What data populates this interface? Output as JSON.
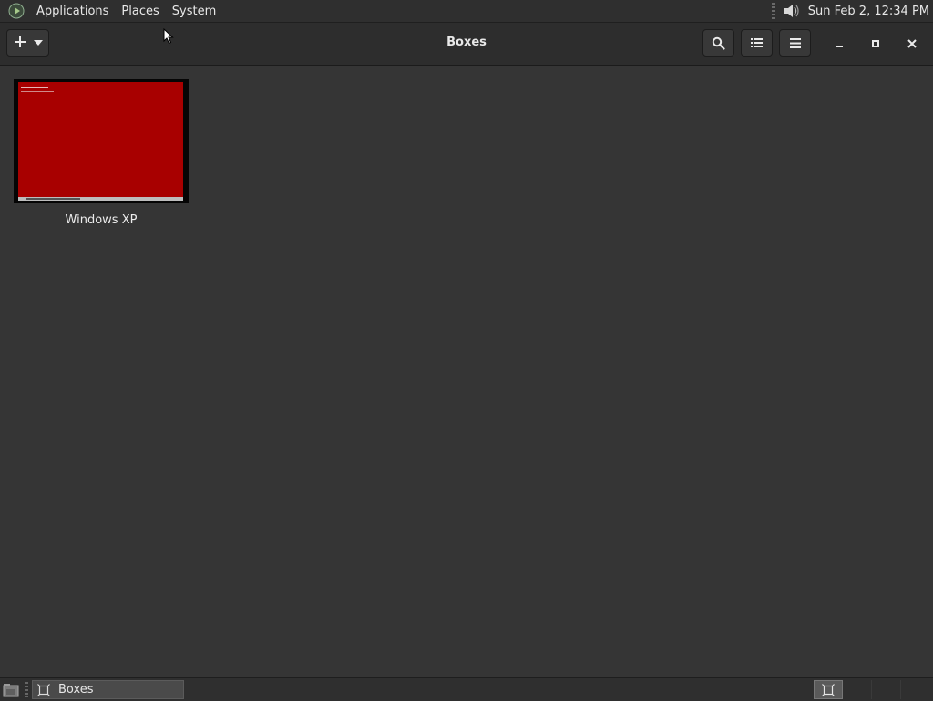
{
  "top_panel": {
    "menus": [
      "Applications",
      "Places",
      "System"
    ],
    "clock": "Sun Feb  2, 12:34 PM"
  },
  "header": {
    "title": "Boxes",
    "icons": {
      "new": "plus-icon",
      "new_dropdown": "chevron-down-icon",
      "search": "search-icon",
      "view": "list-view-icon",
      "menu": "hamburger-menu-icon",
      "minimize": "minimize-icon",
      "maximize": "maximize-icon",
      "close": "close-icon"
    }
  },
  "boxes": [
    {
      "name": "Windows XP"
    }
  ],
  "taskbar": {
    "items": [
      {
        "label": "Boxes"
      }
    ]
  },
  "colors": {
    "background": "#353535",
    "panel": "#2f2f2f",
    "vm_screen": "#a80000"
  }
}
